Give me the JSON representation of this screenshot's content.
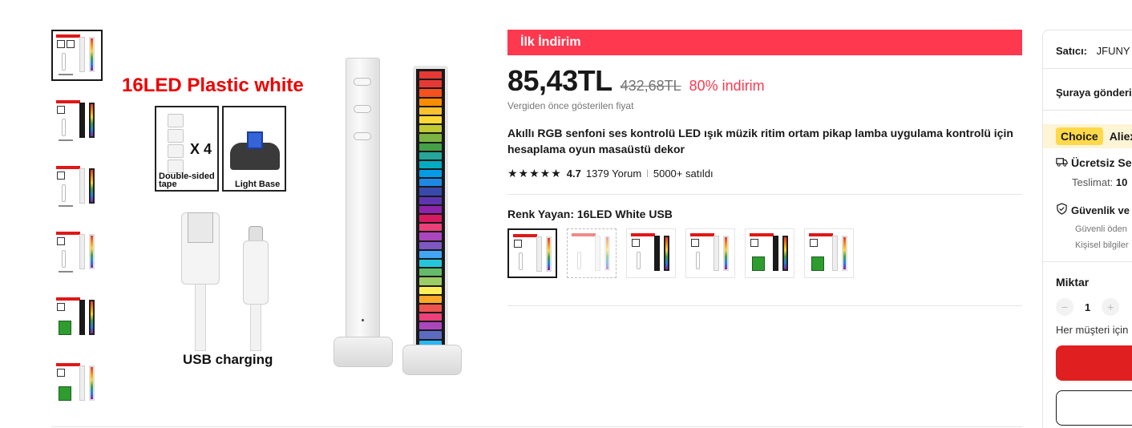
{
  "main_image": {
    "headline": "16LED Plastic white",
    "tape_label": "Double-sided tape",
    "tape_count": "X 4",
    "base_label": "Light Base",
    "usb_caption": "USB charging"
  },
  "product": {
    "promo": "İlk İndirim",
    "price": "85,43TL",
    "old_price": "432,68TL",
    "discount": "80% indirim",
    "tax_note": "Vergiden önce gösterilen fiyat",
    "title": "Akıllı RGB senfoni ses kontrolü LED ışık müzik ritim ortam pikap lamba uygulama kontrolü için hesaplama oyun masaüstü dekor",
    "stars": "★★★★★",
    "rating": "4.7",
    "reviews": "1379 Yorum",
    "sold": "5000+ satıldı",
    "color_label": "Renk Yayan: 16LED White USB"
  },
  "side": {
    "seller_label": "Satıcı:",
    "seller_name": "JFUNY",
    "ship_to": "Şuraya gönderi",
    "choice_badge": "Choice",
    "choice_text": "Aliex",
    "free_shipping": "Ücretsiz Se",
    "delivery_label": "Teslimat:",
    "delivery_value": "10",
    "security_title": "Güvenlik ve",
    "security_line1": "Güvenli öden",
    "security_line2": "Kişisel bilgiler",
    "qty_title": "Miktar",
    "qty_minus": "−",
    "qty_value": "1",
    "qty_plus": "+",
    "per_customer": "Her müşteri için"
  },
  "colors": {
    "accent": "#fd384f",
    "choice_bg": "#fef4d6",
    "choice_badge": "#ffd94a",
    "buy_button": "#e02020"
  }
}
